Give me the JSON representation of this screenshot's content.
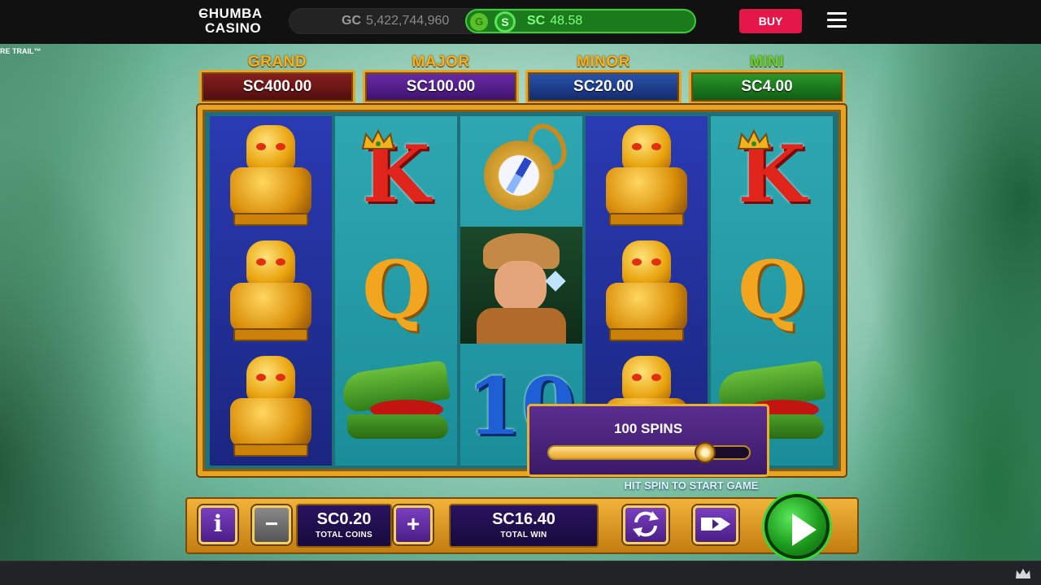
{
  "header": {
    "logo_line1": "CHUMBA",
    "logo_line2": "CASINO",
    "gc_label": "GC",
    "gc_value": "5,422,744,960",
    "sc_label": "SC",
    "sc_value": "48.58",
    "toggle_g": "G",
    "toggle_s": "S",
    "buy_label": "BUY",
    "menu_icon": "hamburger-menu-icon"
  },
  "game": {
    "title_fragment": "RE TRAIL™"
  },
  "jackpots": [
    {
      "name": "GRAND",
      "value": "SC400.00",
      "title_color": "#f5b21c",
      "box_color": "#7a1a1a"
    },
    {
      "name": "MAJOR",
      "value": "SC100.00",
      "title_color": "#f5b21c",
      "box_color": "#5b1e96"
    },
    {
      "name": "MINOR",
      "value": "SC20.00",
      "title_color": "#f5b21c",
      "box_color": "#1d3f8a"
    },
    {
      "name": "MINI",
      "value": "SC4.00",
      "title_color": "#5cd92a",
      "box_color": "#1e7a1e"
    }
  ],
  "reels": [
    [
      "golden-idol",
      "golden-idol",
      "golden-idol"
    ],
    [
      "king-k",
      "queen-q",
      "crocodile"
    ],
    [
      "compass",
      "explorer",
      "ten"
    ],
    [
      "golden-idol",
      "golden-idol",
      "golden-idol"
    ],
    [
      "king-k",
      "queen-q",
      "crocodile"
    ]
  ],
  "symbol_text": {
    "king": "K",
    "queen": "Q",
    "ten": "10"
  },
  "autospin": {
    "label": "100 SPINS",
    "level_fraction": 0.78,
    "hint": "HIT SPIN TO START GAME"
  },
  "controls": {
    "info_label": "i",
    "minus_label": "−",
    "plus_label": "+",
    "total_coins_value": "SC0.20",
    "total_coins_caption": "TOTAL COINS",
    "total_win_value": "SC16.40",
    "total_win_caption": "TOTAL WIN",
    "autoplay_icon": "refresh-cycle-icon",
    "turbo_icon": "fast-forward-tag-icon",
    "spin_icon": "play-triangle-icon"
  },
  "footer": {
    "crown_icon": "crown-icon"
  },
  "colors": {
    "buy": "#e5174a",
    "sc_green": "#3ccc3c",
    "frame_gold": "#e6a420",
    "control_purple": "#5a2e8e"
  }
}
